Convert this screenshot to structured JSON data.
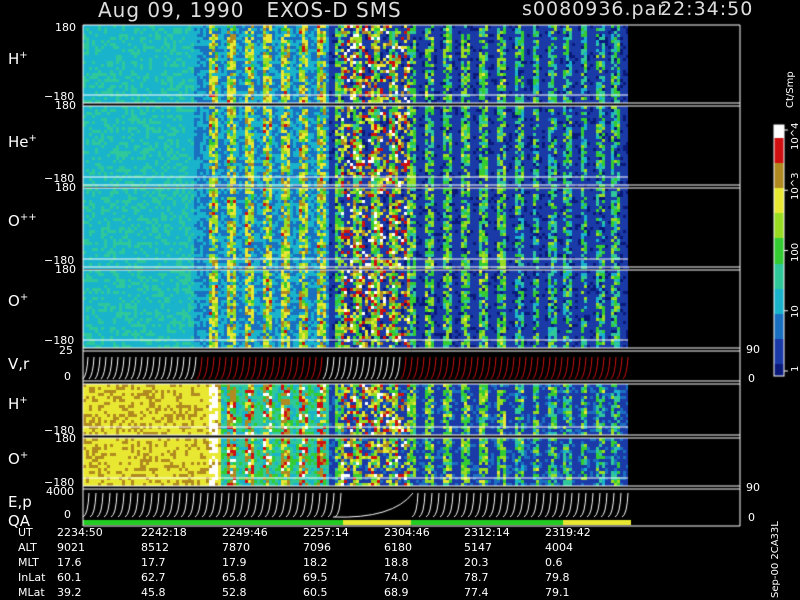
{
  "header": {
    "title": "Aug 09, 1990   EXOS-D SMS",
    "file": "s0080936.par",
    "time": "22:34:50"
  },
  "footer_note": "Sep-00 2CA33L",
  "colors": {
    "background": "#000000",
    "panel_bg": "#0a1a7a",
    "cyan": "#19b3cc",
    "green": "#33cc33",
    "yellow": "#e8e833",
    "red": "#d01010",
    "white": "#ffffff",
    "qa_green": "#22cc22",
    "qa_yellow": "#e8e833"
  },
  "chart_data": {
    "type": "heatmap",
    "colorbar": {
      "label": "Ct/Smp",
      "ticks": [
        "1",
        "10",
        "100",
        "10^3",
        "10^4"
      ],
      "tick_values": [
        1,
        10,
        100,
        1000,
        10000
      ],
      "scale": "log"
    },
    "panels": [
      {
        "label": "H+",
        "ymax": "180",
        "ymin": "−180",
        "kind": "angle"
      },
      {
        "label": "He+",
        "ymax": "180",
        "ymin": "−180",
        "kind": "angle"
      },
      {
        "label": "O++",
        "ymax": "180",
        "ymin": "−180",
        "kind": "angle"
      },
      {
        "label": "O+",
        "ymax": "180",
        "ymin": "−180",
        "kind": "angle"
      },
      {
        "label": "V,r",
        "ymax": "25",
        "ymin": "0",
        "right_max": "90",
        "right_min": "0",
        "kind": "line"
      },
      {
        "label": "H+",
        "ymax": "180",
        "ymin": "−180",
        "kind": "angle"
      },
      {
        "label": "O+",
        "ymax": "180",
        "ymin": "−180",
        "kind": "angle"
      },
      {
        "label": "E,p",
        "ymax": "4000",
        "ymin": "0",
        "right_max": "90",
        "right_min": "0",
        "kind": "line"
      }
    ],
    "qa_label": "QA",
    "ephemeris": {
      "rows": [
        {
          "name": "UT",
          "values": [
            "2234:50",
            "2242:18",
            "2249:46",
            "2257:14",
            "2304:46",
            "2312:14",
            "2319:42"
          ]
        },
        {
          "name": "ALT",
          "values": [
            "9021",
            "8512",
            "7870",
            "7096",
            "6180",
            "5147",
            "4004"
          ]
        },
        {
          "name": "MLT",
          "values": [
            "17.6",
            "17.7",
            "17.9",
            "18.2",
            "18.8",
            "20.3",
            "0.6"
          ]
        },
        {
          "name": "InLat",
          "values": [
            "60.1",
            "62.7",
            "65.8",
            "69.5",
            "74.0",
            "78.7",
            "79.8"
          ]
        },
        {
          "name": "MLat",
          "values": [
            "39.2",
            "45.8",
            "52.8",
            "60.5",
            "68.9",
            "77.4",
            "79.1"
          ]
        }
      ]
    }
  }
}
